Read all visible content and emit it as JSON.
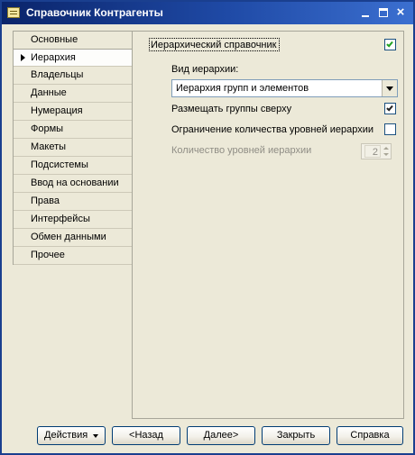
{
  "window": {
    "title": "Справочник Контрагенты"
  },
  "sidebar": {
    "items": [
      {
        "label": "Основные"
      },
      {
        "label": "Иерархия",
        "active": true
      },
      {
        "label": "Владельцы"
      },
      {
        "label": "Данные"
      },
      {
        "label": "Нумерация"
      },
      {
        "label": "Формы"
      },
      {
        "label": "Макеты"
      },
      {
        "label": "Подсистемы"
      },
      {
        "label": "Ввод на основании"
      },
      {
        "label": "Права"
      },
      {
        "label": "Интерфейсы"
      },
      {
        "label": "Обмен данными"
      },
      {
        "label": "Прочее"
      }
    ]
  },
  "hierarchy": {
    "is_hierarchical": {
      "label": "Иерархический справочник",
      "checked": true
    },
    "type_label": "Вид иерархии:",
    "type_value": "Иерархия групп и элементов",
    "groups_on_top": {
      "label": "Размещать группы сверху",
      "checked": true
    },
    "limit_levels": {
      "label": "Ограничение количества уровней иерархии",
      "checked": false
    },
    "levels_count": {
      "label": "Количество уровней иерархии",
      "value": "2"
    }
  },
  "footer": {
    "actions": "Действия",
    "back": "<Назад",
    "next": "Далее>",
    "close": "Закрыть",
    "help": "Справка"
  },
  "colors": {
    "titlebar": "#0a246a",
    "face": "#ece9d8",
    "check": "#21a121"
  }
}
